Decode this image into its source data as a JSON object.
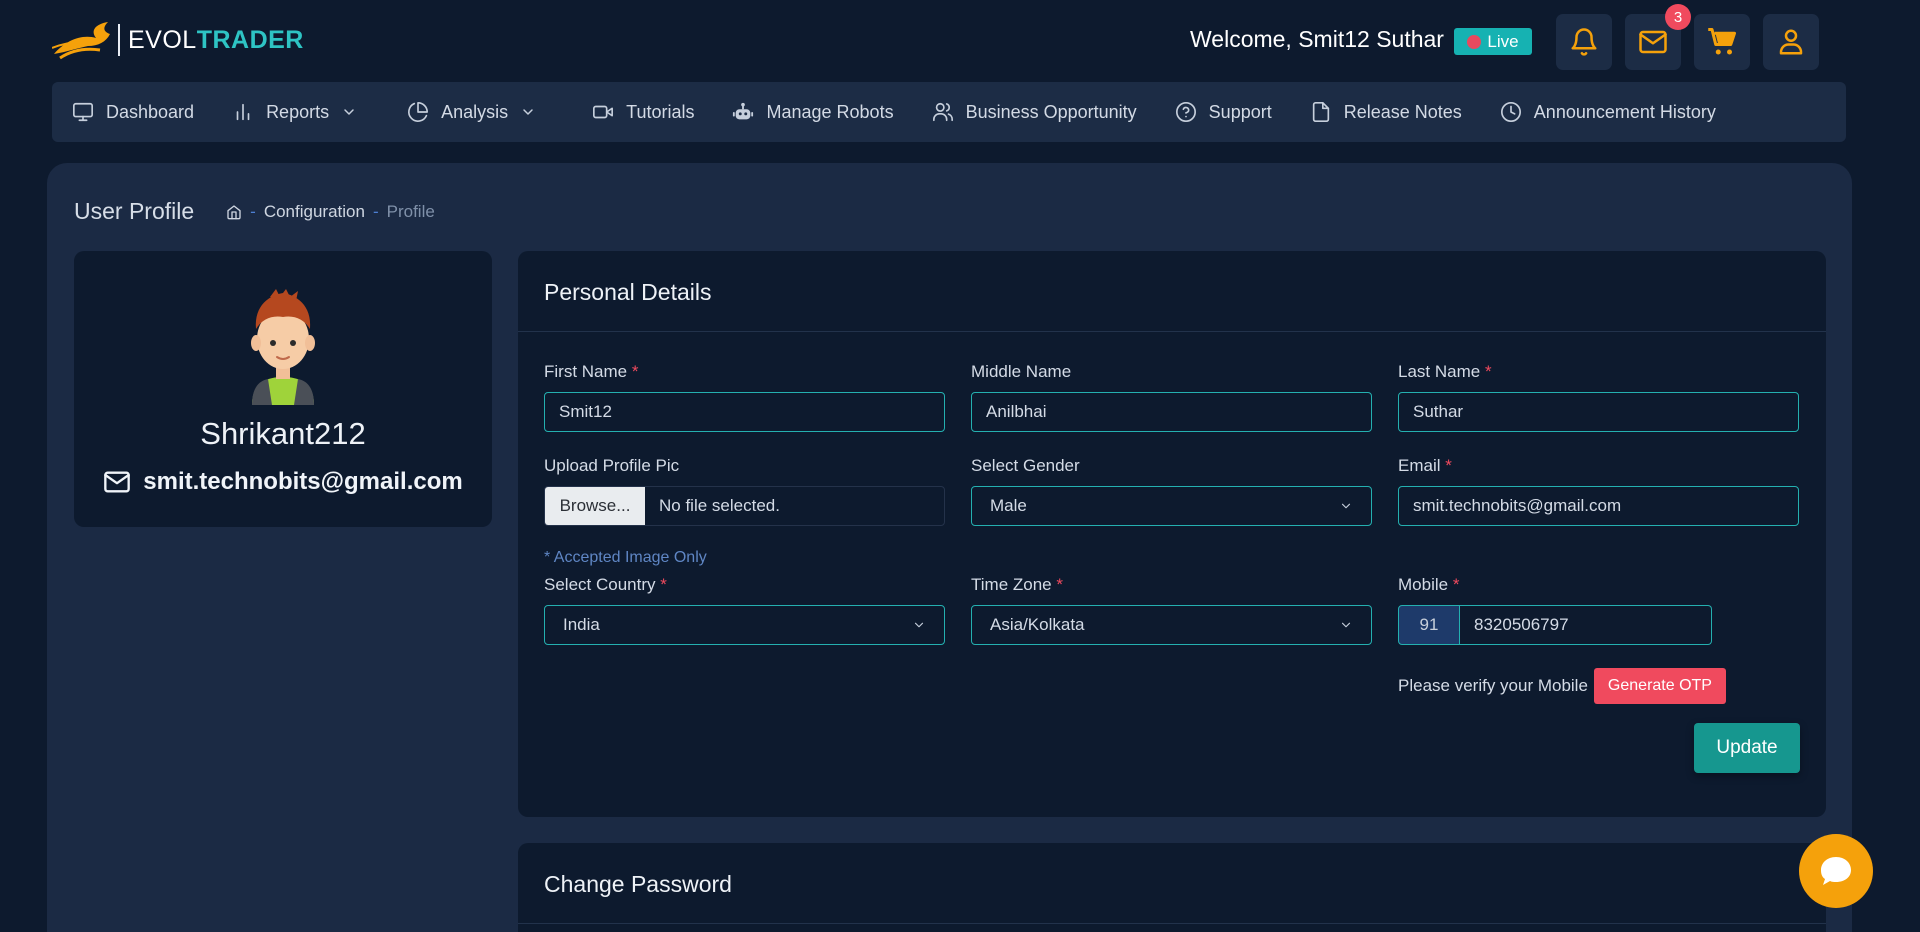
{
  "brand": {
    "part1": "EVOL",
    "part2": "TRADER"
  },
  "header": {
    "welcome": "Welcome, Smit12 Suthar",
    "live_label": "Live",
    "mail_count": "3"
  },
  "nav": [
    {
      "label": "Dashboard"
    },
    {
      "label": "Reports"
    },
    {
      "label": "Analysis"
    },
    {
      "label": "Tutorials"
    },
    {
      "label": "Manage Robots"
    },
    {
      "label": "Business Opportunity"
    },
    {
      "label": "Support"
    },
    {
      "label": "Release Notes"
    },
    {
      "label": "Announcement History"
    }
  ],
  "page": {
    "title": "User Profile",
    "breadcrumb": [
      "Configuration",
      "Profile"
    ]
  },
  "profile": {
    "username": "Shrikant212",
    "email": "smit.technobits@gmail.com"
  },
  "personal": {
    "title": "Personal Details",
    "first_name": {
      "label": "First Name",
      "value": "Smit12"
    },
    "middle_name": {
      "label": "Middle Name",
      "value": "Anilbhai"
    },
    "last_name": {
      "label": "Last Name",
      "value": "Suthar"
    },
    "upload": {
      "label": "Upload Profile Pic",
      "button": "Browse...",
      "status": "No file selected.",
      "note": "* Accepted Image Only"
    },
    "gender": {
      "label": "Select Gender",
      "value": "Male"
    },
    "email": {
      "label": "Email",
      "value": "smit.technobits@gmail.com"
    },
    "country": {
      "label": "Select Country",
      "value": "India"
    },
    "timezone": {
      "label": "Time Zone",
      "value": "Asia/Kolkata"
    },
    "mobile": {
      "label": "Mobile",
      "code": "91",
      "value": "8320506797"
    },
    "verify_text": "Please verify your Mobile",
    "otp_button": "Generate OTP",
    "update_button": "Update"
  },
  "password": {
    "title": "Change Password"
  },
  "colors": {
    "background": "#0d1a2e",
    "panel": "#1b2a44",
    "accent_teal": "#24b0b0",
    "danger": "#f04a5e",
    "chat": "#f5a10b"
  }
}
